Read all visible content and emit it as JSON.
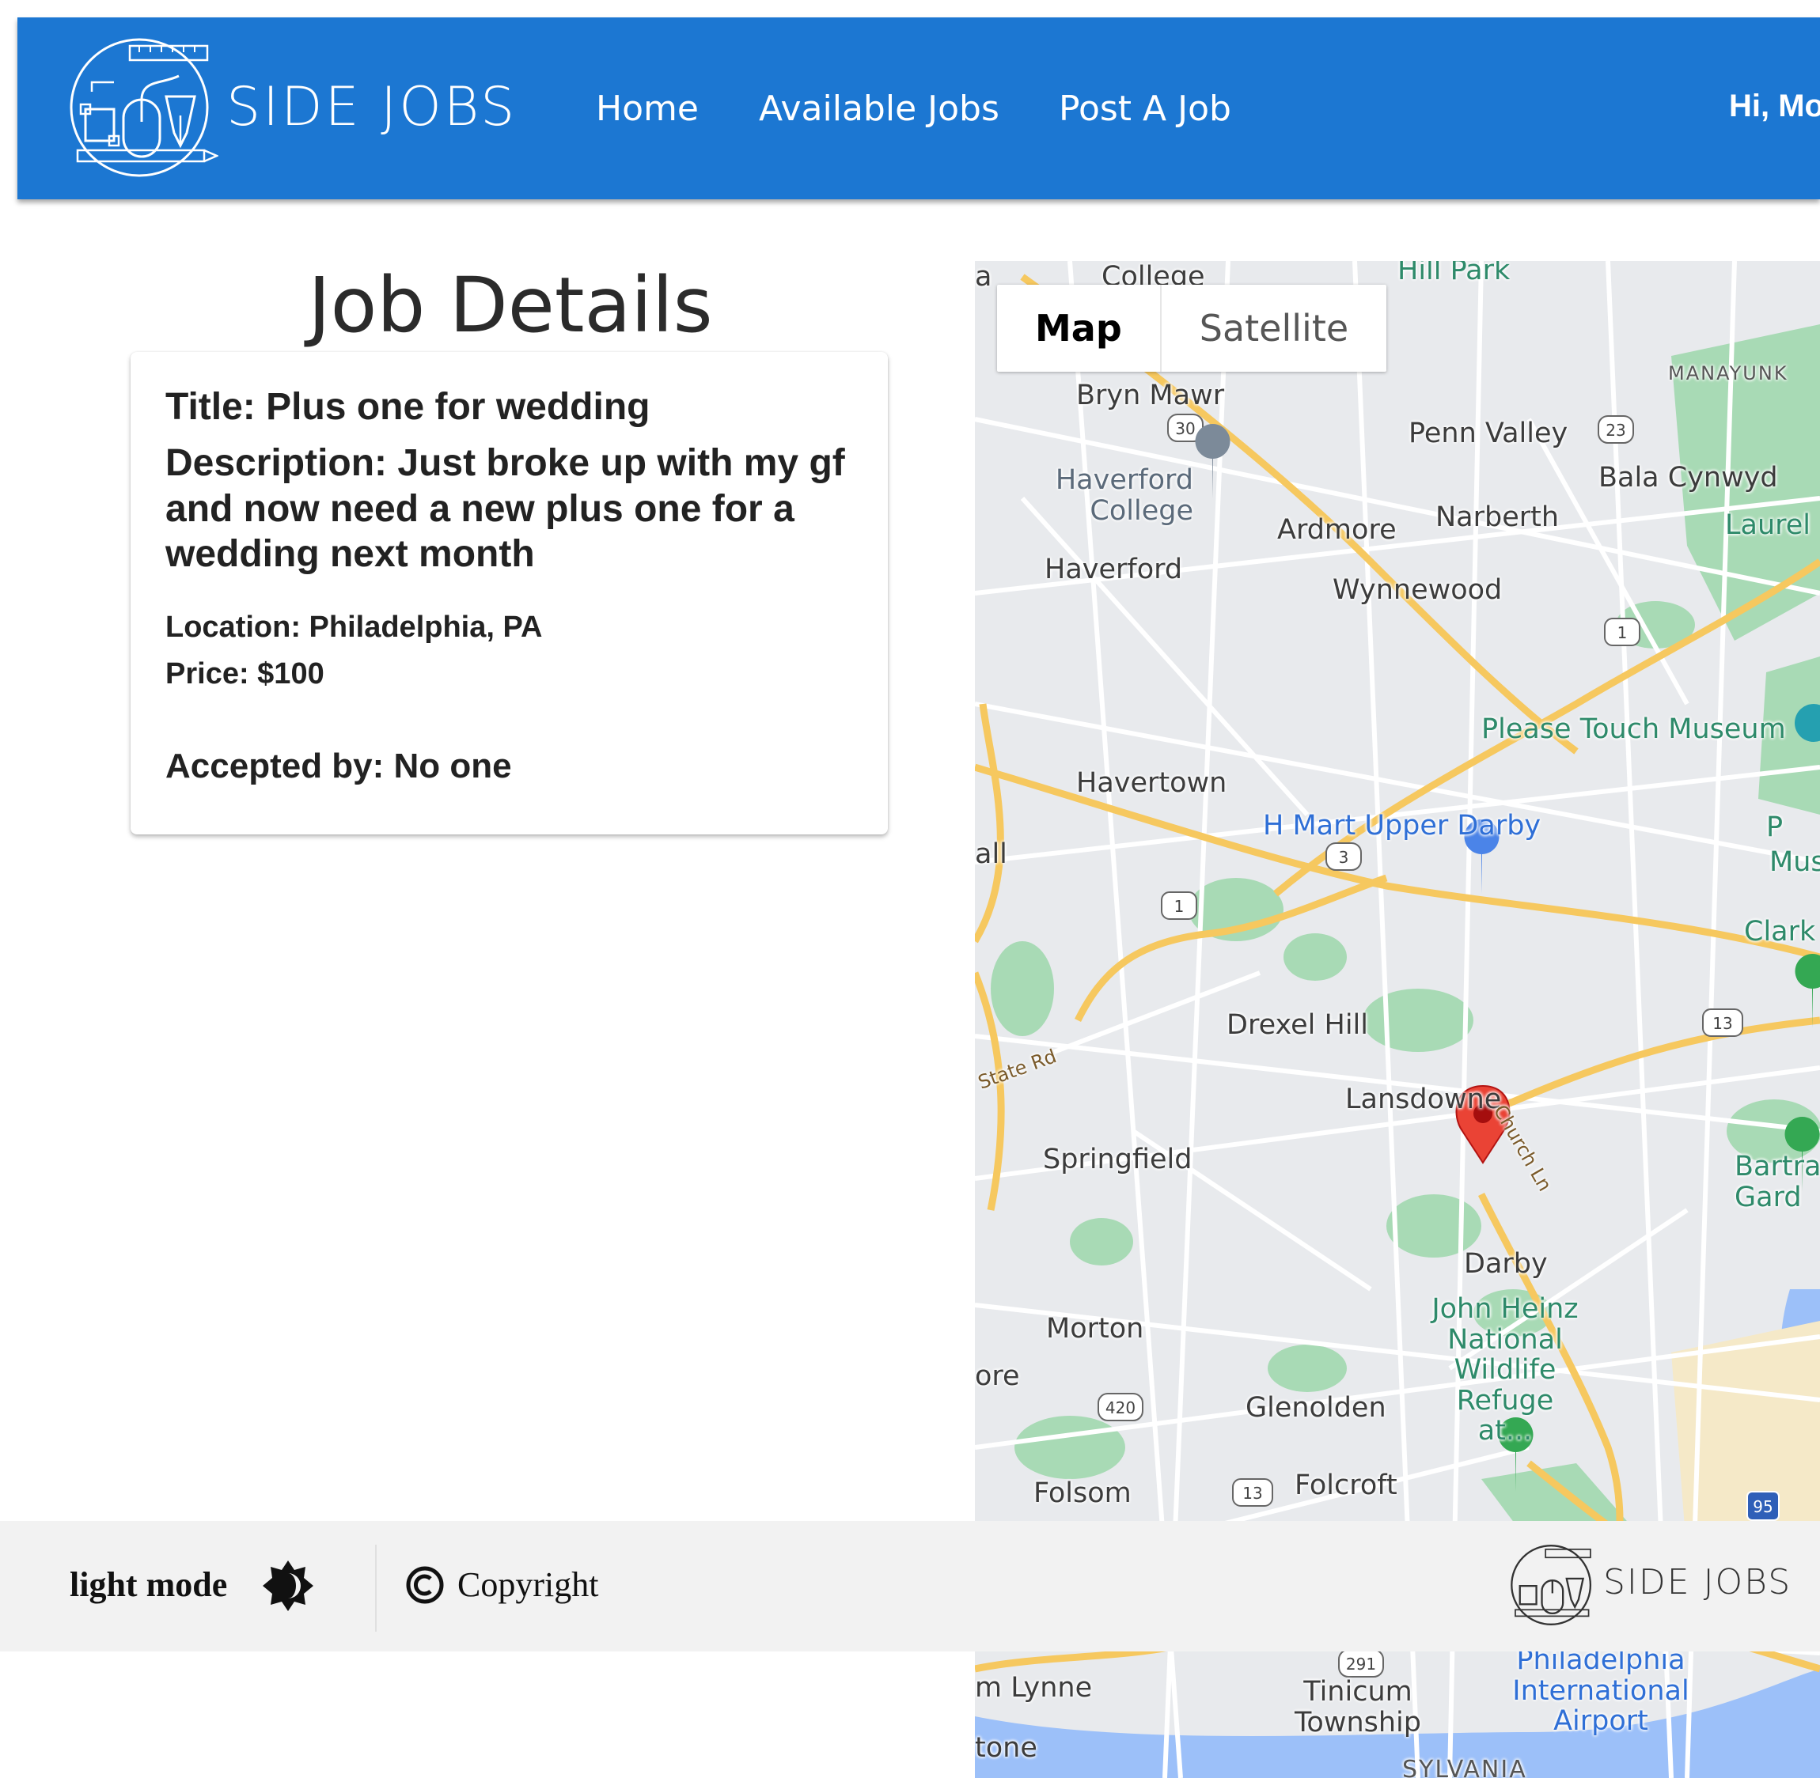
{
  "header": {
    "brand": "SIDE JOBS",
    "nav": [
      "Home",
      "Available Jobs",
      "Post A Job"
    ],
    "greeting": "Hi, Mo"
  },
  "page": {
    "title": "Job Details"
  },
  "job": {
    "title": "Title: Plus one for wedding",
    "description": "Description: Just broke up with my gf and now need a new plus one for a wedding next month",
    "location": "Location: Philadelphia, PA",
    "price": "Price: $100",
    "accepted_by": "Accepted by: No one"
  },
  "map": {
    "type_buttons": [
      "Map",
      "Satellite"
    ],
    "selected_type": "Map",
    "labels": {
      "college": "College",
      "hill_park": "Hill Park",
      "manayunk": "MANAYUNK",
      "bryn_mawr": "Bryn Mawr",
      "penn_valley": "Penn Valley",
      "bala_cynwyd": "Bala Cynwyd",
      "haverford_college": "Haverford College",
      "ardmore": "Ardmore",
      "narberth": "Narberth",
      "laurel": "Laurel",
      "haverford": "Haverford",
      "wynnewood": "Wynnewood",
      "please_touch": "Please Touch Museum",
      "havertown": "Havertown",
      "hmart": "H Mart Upper Darby",
      "clark": "Clark",
      "drexel_hill": "Drexel Hill",
      "state_rd": "State Rd",
      "lansdowne": "Lansdowne",
      "church_ln": "Church Ln",
      "springfield": "Springfield",
      "bartram": "Bartra Gard",
      "darby": "Darby",
      "heinz": "John Heinz National Wildlife Refuge at...",
      "morton": "Morton",
      "glenolden": "Glenolden",
      "folsom": "Folsom",
      "folcroft": "Folcroft",
      "m_lynne": "m Lynne",
      "tinicum": "Tinicum Township",
      "airport": "Philadelphia International Airport",
      "tone": "tone",
      "ore": "ore",
      "all": "all",
      "a": "a",
      "mus": "Mus",
      "p": "P",
      "pennsylvania": "SYLVANIA"
    },
    "shields": [
      "30",
      "23",
      "1",
      "3",
      "1",
      "13",
      "420",
      "13",
      "291",
      "95"
    ]
  },
  "footer": {
    "mode_label": "light mode",
    "copyright": "Copyright",
    "brand": "SIDE JOBS"
  },
  "colors": {
    "header_bg": "#1c77d2",
    "footer_bg": "#f2f2f2",
    "map_bg": "#e8eaed",
    "pin": "#ea4335"
  }
}
